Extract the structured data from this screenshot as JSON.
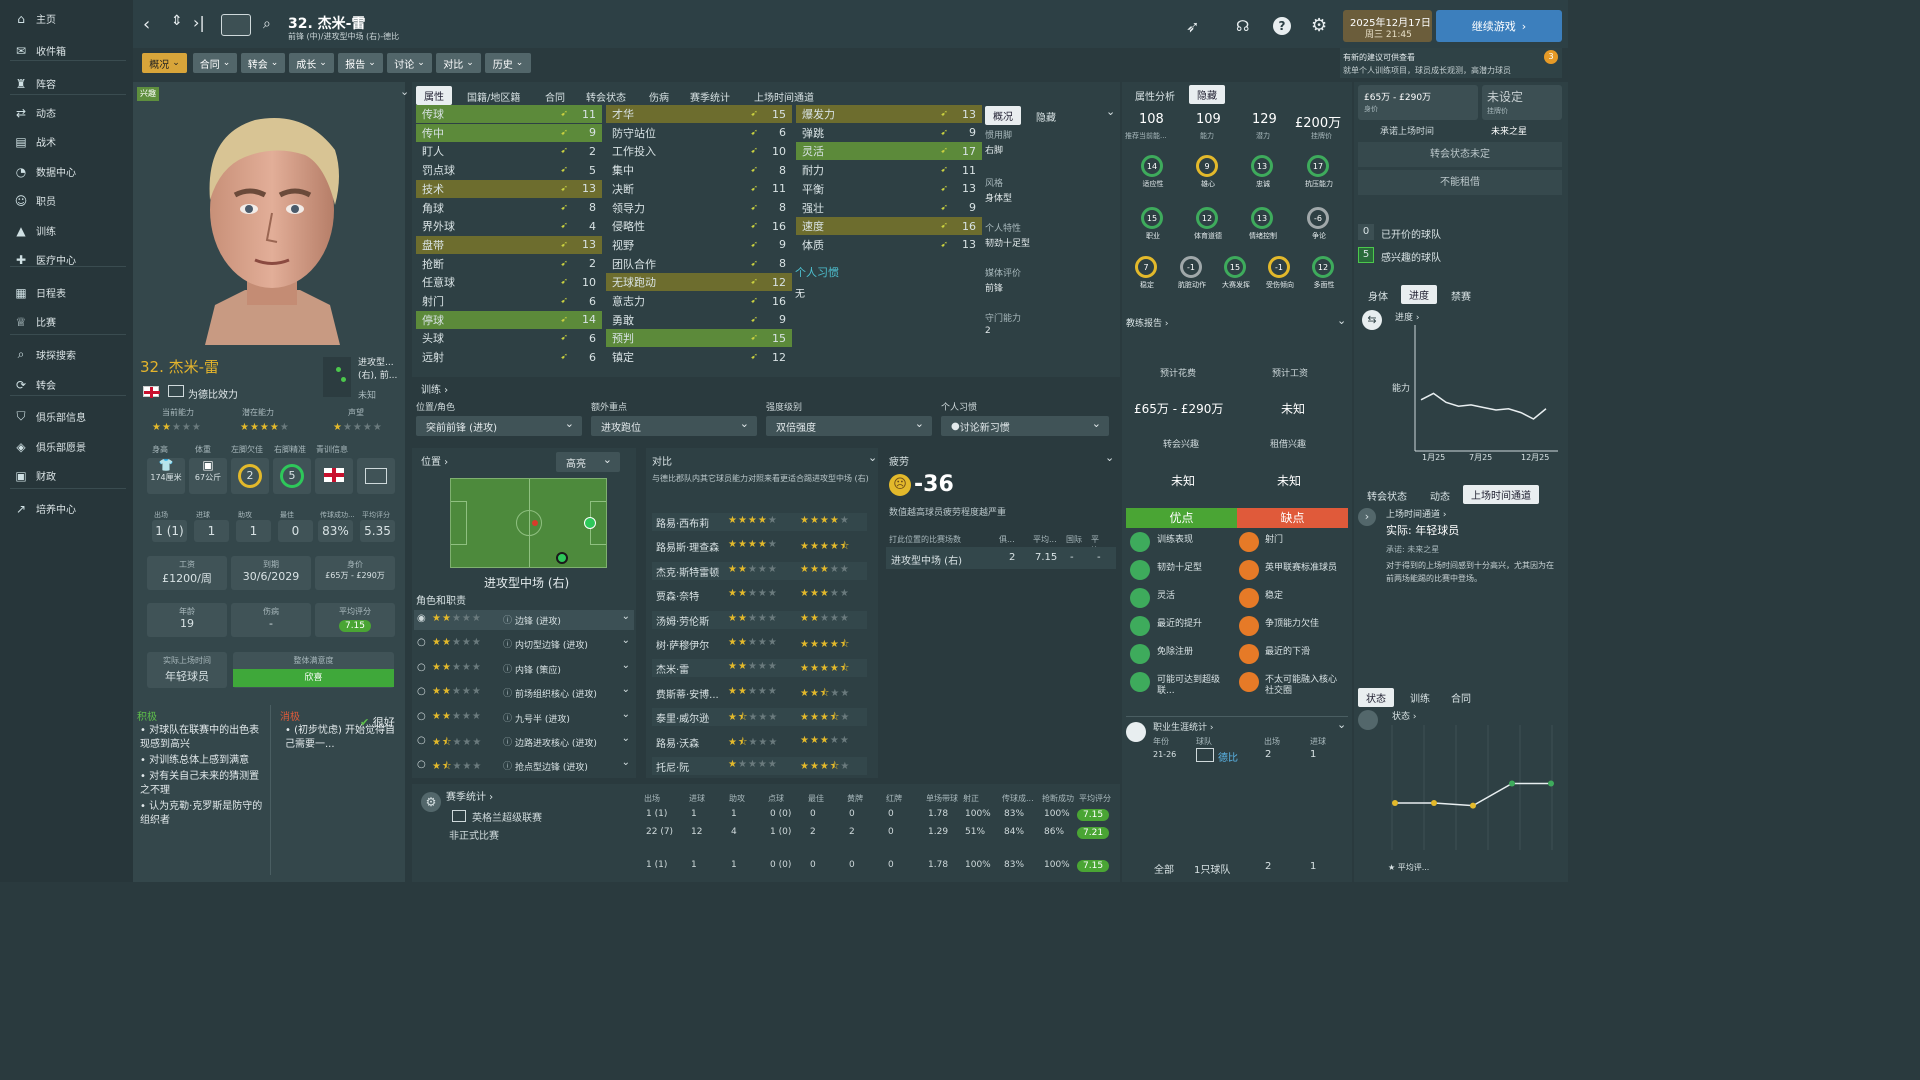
{
  "sidebar": {
    "items": [
      {
        "label": "主页",
        "icon": "home-icon"
      },
      {
        "label": "收件箱",
        "icon": "inbox-icon"
      },
      {
        "label": "阵容",
        "icon": "shirt-icon"
      },
      {
        "label": "动态",
        "icon": "arrows-icon"
      },
      {
        "label": "战术",
        "icon": "tactics-icon"
      },
      {
        "label": "数据中心",
        "icon": "data-icon"
      },
      {
        "label": "职员",
        "icon": "staff-icon"
      },
      {
        "label": "训练",
        "icon": "training-icon"
      },
      {
        "label": "医疗中心",
        "icon": "medical-icon"
      },
      {
        "label": "日程表",
        "icon": "calendar-icon"
      },
      {
        "label": "比赛",
        "icon": "trophy-icon"
      },
      {
        "label": "球探搜索",
        "icon": "search-icon"
      },
      {
        "label": "转会",
        "icon": "transfer-icon"
      },
      {
        "label": "俱乐部信息",
        "icon": "shield-icon"
      },
      {
        "label": "俱乐部愿景",
        "icon": "vision-icon"
      },
      {
        "label": "财政",
        "icon": "finance-icon"
      },
      {
        "label": "培养中心",
        "icon": "development-icon"
      }
    ]
  },
  "header": {
    "player_title": "32. 杰米-雷",
    "player_sub": "前锋 (中)/进攻型中场 (右)-德比",
    "date": "2025年12月17日",
    "weekday_time": "周三 21:45",
    "continue": "继续游戏",
    "notice_title": "有新的建议可供查看",
    "notice_body": "就单个人训练项目，球员成长观测，高潜力球员",
    "notice_count": "3"
  },
  "menu": [
    "概况",
    "合同",
    "转会",
    "成长",
    "报告",
    "讨论",
    "对比",
    "历史"
  ],
  "profile": {
    "badge": "兴趣",
    "name": "32. 杰米-雷",
    "club_line": "为德比效力",
    "position_short": "进攻型...(右), 前...",
    "unknown": "未知",
    "ability_labels": [
      "当前能力",
      "潜在能力",
      "声望"
    ],
    "height_label": "身高",
    "weight_label": "体重",
    "leftfoot_label": "左脚欠佳",
    "rightfoot_label": "右脚精准",
    "youth_label": "青训信息",
    "height": "174厘米",
    "weight": "67公斤",
    "leftfoot": "2",
    "rightfoot": "5",
    "stat_labels": [
      "出场",
      "进球",
      "助攻",
      "最佳",
      "传球成功...",
      "平均评分"
    ],
    "stat_values": [
      "1 (1)",
      "1",
      "1",
      "0",
      "83%",
      "5.35"
    ],
    "wage_label": "工资",
    "wage": "£1200/周",
    "expiry_label": "到期",
    "expiry": "30/6/2029",
    "value_label": "身价",
    "value": "£65万 - £290万",
    "age_label": "年龄",
    "age": "19",
    "injury_label": "伤病",
    "injury": "-",
    "rating_label": "平均评分",
    "rating": "7.15",
    "role_label": "实际上场时间",
    "role": "年轻球员",
    "satisfaction_label": "整体满意度",
    "satisfaction": "欣喜",
    "positive_label": "积极",
    "negative_label": "消极",
    "positives": [
      "对球队在联赛中的出色表现感到高兴",
      "对训练总体上感到满意",
      "对有关自己未来的猜测置之不理",
      "认为克勒·克罗斯是防守的组织者"
    ],
    "negative": "(初步忧虑) 开始觉得自己需要一...",
    "mood": "很好"
  },
  "attr_tabs": [
    "属性",
    "国籍/地区籍",
    "合同",
    "转会状态",
    "伤病",
    "赛季统计",
    "上场时间通道"
  ],
  "attrs_technical": [
    [
      "传球",
      "11"
    ],
    [
      "传中",
      "9"
    ],
    [
      "盯人",
      "2"
    ],
    [
      "罚点球",
      "5"
    ],
    [
      "技术",
      "13"
    ],
    [
      "角球",
      "8"
    ],
    [
      "界外球",
      "4"
    ],
    [
      "盘带",
      "13"
    ],
    [
      "抢断",
      "2"
    ],
    [
      "任意球",
      "10"
    ],
    [
      "射门",
      "6"
    ],
    [
      "停球",
      "14"
    ],
    [
      "头球",
      "6"
    ],
    [
      "远射",
      "6"
    ]
  ],
  "attrs_mental": [
    [
      "才华",
      "15"
    ],
    [
      "防守站位",
      "6"
    ],
    [
      "工作投入",
      "10"
    ],
    [
      "集中",
      "8"
    ],
    [
      "决断",
      "11"
    ],
    [
      "领导力",
      "8"
    ],
    [
      "侵略性",
      "16"
    ],
    [
      "视野",
      "9"
    ],
    [
      "团队合作",
      "8"
    ],
    [
      "无球跑动",
      "12"
    ],
    [
      "意志力",
      "16"
    ],
    [
      "勇敢",
      "9"
    ],
    [
      "预判",
      "15"
    ],
    [
      "镇定",
      "12"
    ]
  ],
  "attrs_physical": [
    [
      "爆发力",
      "13"
    ],
    [
      "弹跳",
      "9"
    ],
    [
      "灵活",
      "17"
    ],
    [
      "耐力",
      "11"
    ],
    [
      "平衡",
      "13"
    ],
    [
      "强壮",
      "9"
    ],
    [
      "速度",
      "16"
    ],
    [
      "体质",
      "13"
    ]
  ],
  "habits_label": "个人习惯",
  "habits_value": "无",
  "side_tabs": [
    "概况",
    "隐藏"
  ],
  "side_info": [
    [
      "惯用脚",
      "右脚"
    ],
    [
      "风格",
      "身体型"
    ],
    [
      "个人特性",
      "韧劲十足型"
    ],
    [
      "媒体评价",
      "前锋"
    ],
    [
      "守门能力",
      "2"
    ]
  ],
  "training": {
    "label": "训练",
    "pos_label": "位置/角色",
    "focus_label": "额外重点",
    "intensity_label": "强度级别",
    "habit_label": "个人习惯",
    "pos": "突前前锋 (进攻)",
    "focus": "进攻跑位",
    "intensity": "双倍强度",
    "habit": "讨论新习惯"
  },
  "position": {
    "label": "位置",
    "highlight": "高亮",
    "name": "进攻型中场 (右)",
    "roles_label": "角色和职责",
    "roles": [
      "边锋 (进攻)",
      "内切型边锋 (进攻)",
      "内锋 (策应)",
      "前场组织核心 (进攻)",
      "九号半 (进攻)",
      "边路进攻核心 (进攻)",
      "抢点型边锋 (进攻)"
    ]
  },
  "compare": {
    "label": "对比",
    "desc": "与德比郡队内其它球员能力对照来看更适合踢进攻型中场 (右)",
    "players": [
      "路易·西布莉",
      "路易斯·理查森",
      "杰克·斯特雷顿",
      "贾森·奈特",
      "汤姆·劳伦斯",
      "树·萨穆伊尔",
      "杰米·雷",
      "费斯蒂·安博...",
      "泰里·威尔逊",
      "路易·沃森",
      "托尼·阮"
    ]
  },
  "fatigue": {
    "label": "疲劳",
    "value": "-36",
    "desc": "数值越高球员疲劳程度越严重",
    "col1": "打此位置的比赛场数",
    "col2": "俱...",
    "col3": "平均...",
    "col4": "国际",
    "col5": "平均...",
    "row_pos": "进攻型中场 (右)",
    "row_apps": "2",
    "row_avg": "7.15",
    "row_int": "-",
    "row_int_avg": "-"
  },
  "season": {
    "label": "赛季统计",
    "headers": [
      "出场",
      "进球",
      "助攻",
      "点球",
      "最佳",
      "黄牌",
      "红牌",
      "单场带球",
      "射正",
      "传球成...",
      "抢断成功",
      "平均评分"
    ],
    "rows": [
      {
        "name": "英格兰超级联赛",
        "vals": [
          "1 (1)",
          "1",
          "1",
          "0 (0)",
          "0",
          "0",
          "0",
          "1.78",
          "100%",
          "83%",
          "100%"
        ],
        "rating": "7.15"
      },
      {
        "name": "非正式比赛",
        "vals": [
          "22 (7)",
          "12",
          "4",
          "1 (0)",
          "2",
          "2",
          "0",
          "1.29",
          "51%",
          "84%",
          "86%"
        ],
        "rating": "7.21"
      },
      {
        "name": "",
        "vals": [
          "1 (1)",
          "1",
          "1",
          "0 (0)",
          "0",
          "0",
          "0",
          "1.78",
          "100%",
          "83%",
          "100%"
        ],
        "rating": "7.15"
      }
    ]
  },
  "analysis": {
    "tabs": [
      "属性分析",
      "隐藏"
    ],
    "rec_current": "108",
    "rec_current_label": "推荐当前能...",
    "ability": "109",
    "ability_label": "能力",
    "potential": "129",
    "potential_label": "潜力",
    "asking": "£200万",
    "asking_label": "挂牌价",
    "gauges1": [
      [
        "14",
        "适应性"
      ],
      [
        "9",
        "雄心"
      ],
      [
        "13",
        "忠诚"
      ],
      [
        "17",
        "抗压能力"
      ]
    ],
    "gauges2": [
      [
        "15",
        "职业"
      ],
      [
        "12",
        "体育道德"
      ],
      [
        "13",
        "情绪控制"
      ],
      [
        "-6",
        "争论"
      ]
    ],
    "gauges3": [
      [
        "7",
        "稳定"
      ],
      [
        "-1",
        "肮脏动作"
      ],
      [
        "15",
        "大赛发挥"
      ],
      [
        "-1",
        "受伤倾向"
      ],
      [
        "12",
        "多面性"
      ]
    ],
    "coach_report": "教练报告",
    "cost_label": "预计花费",
    "wage_label": "预计工资",
    "cost": "£65万 - £290万",
    "wage": "未知",
    "transfer_label": "转会兴趣",
    "loan_label": "租借兴趣",
    "transfer": "未知",
    "loan": "未知",
    "pros_label": "优点",
    "cons_label": "缺点",
    "pros": [
      "训练表现",
      "韧劲十足型",
      "灵活",
      "最近的提升",
      "免除注册",
      "可能可达到超级联..."
    ],
    "cons": [
      "射门",
      "英甲联赛标准球员",
      "稳定",
      "争顶能力欠佳",
      "最近的下滑",
      "不太可能融入核心社交圈"
    ],
    "career_label": "职业生涯统计",
    "career_year_label": "年份",
    "career_team_label": "球队",
    "career_apps_label": "出场",
    "career_goals_label": "进球",
    "career_year": "21-26",
    "career_team": "德比",
    "career_apps": "2",
    "career_goals": "1",
    "total_label": "全部",
    "total_team": "1只球队",
    "total_apps": "2",
    "total_goals": "1"
  },
  "right": {
    "value_range": "£65万 - £290万",
    "value_label": "身价",
    "unset": "未设定",
    "asking_label": "挂牌价",
    "promised_label": "承诺上场时间",
    "promised": "未来之星",
    "transfer_status": "转会状态未定",
    "no_loan": "不能租借",
    "clubs_offered_count": "0",
    "clubs_offered": "已开价的球队",
    "clubs_interested_count": "5",
    "clubs_interested": "感兴趣的球队",
    "graph_tabs": [
      "身体",
      "进度",
      "禁赛"
    ],
    "progress_label": "进度",
    "ability_label": "能力",
    "xticks": [
      "1月25",
      "7月25",
      "12月25"
    ],
    "status_tabs": [
      "转会状态",
      "动态",
      "上场时间通道"
    ],
    "playtime_label": "上场时间通道",
    "playtime_actual": "实际: 年轻球员",
    "playtime_promised": "承诺: 未来之星",
    "playtime_desc": "对于得到的上场时间感到十分高兴，尤其因为在前两场能踢的比赛中登场。",
    "bottom_tabs": [
      "状态",
      "训练",
      "合同"
    ],
    "status_label": "状态",
    "avg_label": "平均评..."
  },
  "chart_data": {
    "type": "line",
    "title": "",
    "series": [
      {
        "name": "能力",
        "values": [
          0.4,
          0.45,
          0.38,
          0.35,
          0.36,
          0.34,
          0.32,
          0.33,
          0.3,
          0.25,
          0.33
        ]
      }
    ]
  },
  "form_chart": {
    "type": "line",
    "values": [
      0.4,
      0.4,
      0.38,
      0.55,
      0.55
    ]
  }
}
